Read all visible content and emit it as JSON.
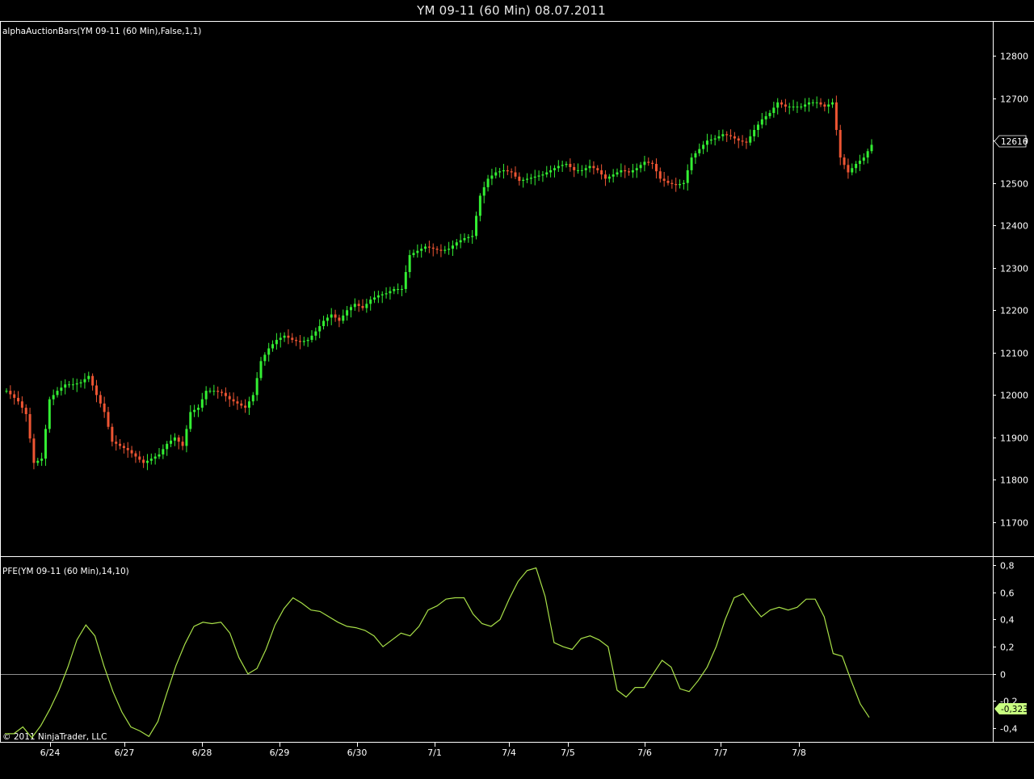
{
  "window": {
    "title": "YM 09-11 (60 Min)  08.07.2011"
  },
  "copyright": "© 2011 NinjaTrader, LLC",
  "colors": {
    "background": "#000000",
    "up": "#33ee33",
    "down": "#ee5533",
    "pfe_line": "#a8e048",
    "current_badge": "#c8ff80"
  },
  "chart_data": [
    {
      "type": "candlestick",
      "panel": "price",
      "label": "alphaAuctionBars(YM 09-11 (60 Min),False,1,1)",
      "ylim": [
        11620,
        12880
      ],
      "yticks": [
        11700,
        11800,
        11900,
        12000,
        12100,
        12200,
        12300,
        12400,
        12500,
        12600,
        12700,
        12800
      ],
      "x_date_labels": [
        "6/24",
        "6/27",
        "6/28",
        "6/29",
        "6/30",
        "7/1",
        "7/4",
        "7/5",
        "7/6",
        "7/7",
        "7/8"
      ],
      "current_value": "12616",
      "close_path": [
        [
          0,
          12010
        ],
        [
          3,
          11985
        ],
        [
          5,
          11955
        ],
        [
          7,
          11840
        ],
        [
          9,
          11850
        ],
        [
          11,
          11990
        ],
        [
          13,
          12010
        ],
        [
          15,
          12025
        ],
        [
          17,
          12025
        ],
        [
          19,
          12030
        ],
        [
          21,
          12045
        ],
        [
          23,
          12000
        ],
        [
          25,
          11960
        ],
        [
          27,
          11890
        ],
        [
          29,
          11880
        ],
        [
          31,
          11870
        ],
        [
          33,
          11855
        ],
        [
          35,
          11840
        ],
        [
          37,
          11850
        ],
        [
          39,
          11860
        ],
        [
          41,
          11885
        ],
        [
          43,
          11900
        ],
        [
          45,
          11880
        ],
        [
          47,
          11960
        ],
        [
          49,
          11970
        ],
        [
          51,
          12010
        ],
        [
          53,
          12010
        ],
        [
          55,
          12005
        ],
        [
          57,
          11990
        ],
        [
          59,
          11980
        ],
        [
          61,
          11970
        ],
        [
          63,
          12000
        ],
        [
          65,
          12080
        ],
        [
          67,
          12110
        ],
        [
          69,
          12130
        ],
        [
          71,
          12140
        ],
        [
          73,
          12130
        ],
        [
          75,
          12125
        ],
        [
          77,
          12130
        ],
        [
          79,
          12150
        ],
        [
          81,
          12175
        ],
        [
          83,
          12190
        ],
        [
          85,
          12175
        ],
        [
          87,
          12200
        ],
        [
          89,
          12215
        ],
        [
          91,
          12205
        ],
        [
          93,
          12225
        ],
        [
          95,
          12235
        ],
        [
          97,
          12240
        ],
        [
          99,
          12250
        ],
        [
          101,
          12250
        ],
        [
          103,
          12330
        ],
        [
          105,
          12340
        ],
        [
          107,
          12350
        ],
        [
          109,
          12345
        ],
        [
          111,
          12340
        ],
        [
          113,
          12345
        ],
        [
          115,
          12360
        ],
        [
          117,
          12370
        ],
        [
          119,
          12375
        ],
        [
          121,
          12470
        ],
        [
          123,
          12510
        ],
        [
          125,
          12525
        ],
        [
          127,
          12530
        ],
        [
          129,
          12525
        ],
        [
          131,
          12505
        ],
        [
          133,
          12510
        ],
        [
          135,
          12515
        ],
        [
          137,
          12520
        ],
        [
          139,
          12530
        ],
        [
          141,
          12540
        ],
        [
          143,
          12545
        ],
        [
          145,
          12530
        ],
        [
          147,
          12530
        ],
        [
          149,
          12540
        ],
        [
          151,
          12530
        ],
        [
          153,
          12510
        ],
        [
          155,
          12520
        ],
        [
          157,
          12530
        ],
        [
          159,
          12525
        ],
        [
          161,
          12535
        ],
        [
          163,
          12550
        ],
        [
          165,
          12545
        ],
        [
          167,
          12510
        ],
        [
          169,
          12500
        ],
        [
          171,
          12495
        ],
        [
          173,
          12500
        ],
        [
          175,
          12560
        ],
        [
          177,
          12580
        ],
        [
          179,
          12600
        ],
        [
          181,
          12605
        ],
        [
          183,
          12615
        ],
        [
          185,
          12610
        ],
        [
          187,
          12600
        ],
        [
          189,
          12595
        ],
        [
          191,
          12625
        ],
        [
          193,
          12650
        ],
        [
          195,
          12665
        ],
        [
          197,
          12690
        ],
        [
          199,
          12680
        ],
        [
          201,
          12680
        ],
        [
          203,
          12680
        ],
        [
          205,
          12690
        ],
        [
          207,
          12690
        ],
        [
          209,
          12680
        ],
        [
          211,
          12690
        ],
        [
          213,
          12560
        ],
        [
          215,
          12525
        ],
        [
          217,
          12545
        ],
        [
          219,
          12560
        ],
        [
          221,
          12590
        ]
      ]
    },
    {
      "type": "line",
      "panel": "indicator",
      "label": "PFE(YM 09-11 (60 Min),14,10)",
      "ylim": [
        -0.5,
        0.86
      ],
      "yticks": [
        "0,8",
        "0,6",
        "0,4",
        "0,2",
        "0",
        "-0,2",
        "-0,4"
      ],
      "ytick_values": [
        0.8,
        0.6,
        0.4,
        0.2,
        0,
        -0.2,
        -0.4
      ],
      "zero_line": true,
      "current_value": "-0,323",
      "y_path": [
        [
          0,
          -0.44
        ],
        [
          2,
          -0.44
        ],
        [
          4,
          -0.39
        ],
        [
          6,
          -0.47
        ],
        [
          8,
          -0.38
        ],
        [
          10,
          -0.26
        ],
        [
          12,
          -0.12
        ],
        [
          14,
          0.05
        ],
        [
          16,
          0.25
        ],
        [
          18,
          0.36
        ],
        [
          20,
          0.28
        ],
        [
          22,
          0.06
        ],
        [
          24,
          -0.13
        ],
        [
          26,
          -0.28
        ],
        [
          28,
          -0.39
        ],
        [
          30,
          -0.42
        ],
        [
          32,
          -0.46
        ],
        [
          34,
          -0.35
        ],
        [
          36,
          -0.14
        ],
        [
          38,
          0.06
        ],
        [
          40,
          0.22
        ],
        [
          42,
          0.35
        ],
        [
          44,
          0.38
        ],
        [
          46,
          0.37
        ],
        [
          48,
          0.38
        ],
        [
          50,
          0.3
        ],
        [
          52,
          0.12
        ],
        [
          54,
          0.0
        ],
        [
          56,
          0.04
        ],
        [
          58,
          0.18
        ],
        [
          60,
          0.36
        ],
        [
          62,
          0.48
        ],
        [
          64,
          0.56
        ],
        [
          66,
          0.52
        ],
        [
          68,
          0.47
        ],
        [
          70,
          0.46
        ],
        [
          72,
          0.42
        ],
        [
          74,
          0.38
        ],
        [
          76,
          0.35
        ],
        [
          78,
          0.34
        ],
        [
          80,
          0.32
        ],
        [
          82,
          0.28
        ],
        [
          84,
          0.2
        ],
        [
          86,
          0.25
        ],
        [
          88,
          0.3
        ],
        [
          90,
          0.28
        ],
        [
          92,
          0.35
        ],
        [
          94,
          0.47
        ],
        [
          96,
          0.5
        ],
        [
          98,
          0.55
        ],
        [
          100,
          0.56
        ],
        [
          102,
          0.56
        ],
        [
          104,
          0.44
        ],
        [
          106,
          0.37
        ],
        [
          108,
          0.35
        ],
        [
          110,
          0.4
        ],
        [
          112,
          0.55
        ],
        [
          114,
          0.68
        ],
        [
          116,
          0.76
        ],
        [
          118,
          0.78
        ],
        [
          120,
          0.57
        ],
        [
          122,
          0.23
        ],
        [
          124,
          0.2
        ],
        [
          126,
          0.18
        ],
        [
          128,
          0.26
        ],
        [
          130,
          0.28
        ],
        [
          132,
          0.25
        ],
        [
          134,
          0.2
        ],
        [
          136,
          -0.12
        ],
        [
          138,
          -0.17
        ],
        [
          140,
          -0.1
        ],
        [
          142,
          -0.1
        ],
        [
          144,
          0.0
        ],
        [
          146,
          0.1
        ],
        [
          148,
          0.05
        ],
        [
          150,
          -0.11
        ],
        [
          152,
          -0.13
        ],
        [
          154,
          -0.05
        ],
        [
          156,
          0.05
        ],
        [
          158,
          0.2
        ],
        [
          160,
          0.4
        ],
        [
          162,
          0.56
        ],
        [
          164,
          0.59
        ],
        [
          166,
          0.5
        ],
        [
          168,
          0.42
        ],
        [
          170,
          0.47
        ],
        [
          172,
          0.49
        ],
        [
          174,
          0.47
        ],
        [
          176,
          0.49
        ],
        [
          178,
          0.55
        ],
        [
          180,
          0.55
        ],
        [
          182,
          0.42
        ],
        [
          184,
          0.15
        ],
        [
          186,
          0.13
        ],
        [
          188,
          -0.05
        ],
        [
          190,
          -0.22
        ],
        [
          192,
          -0.32
        ]
      ]
    }
  ]
}
